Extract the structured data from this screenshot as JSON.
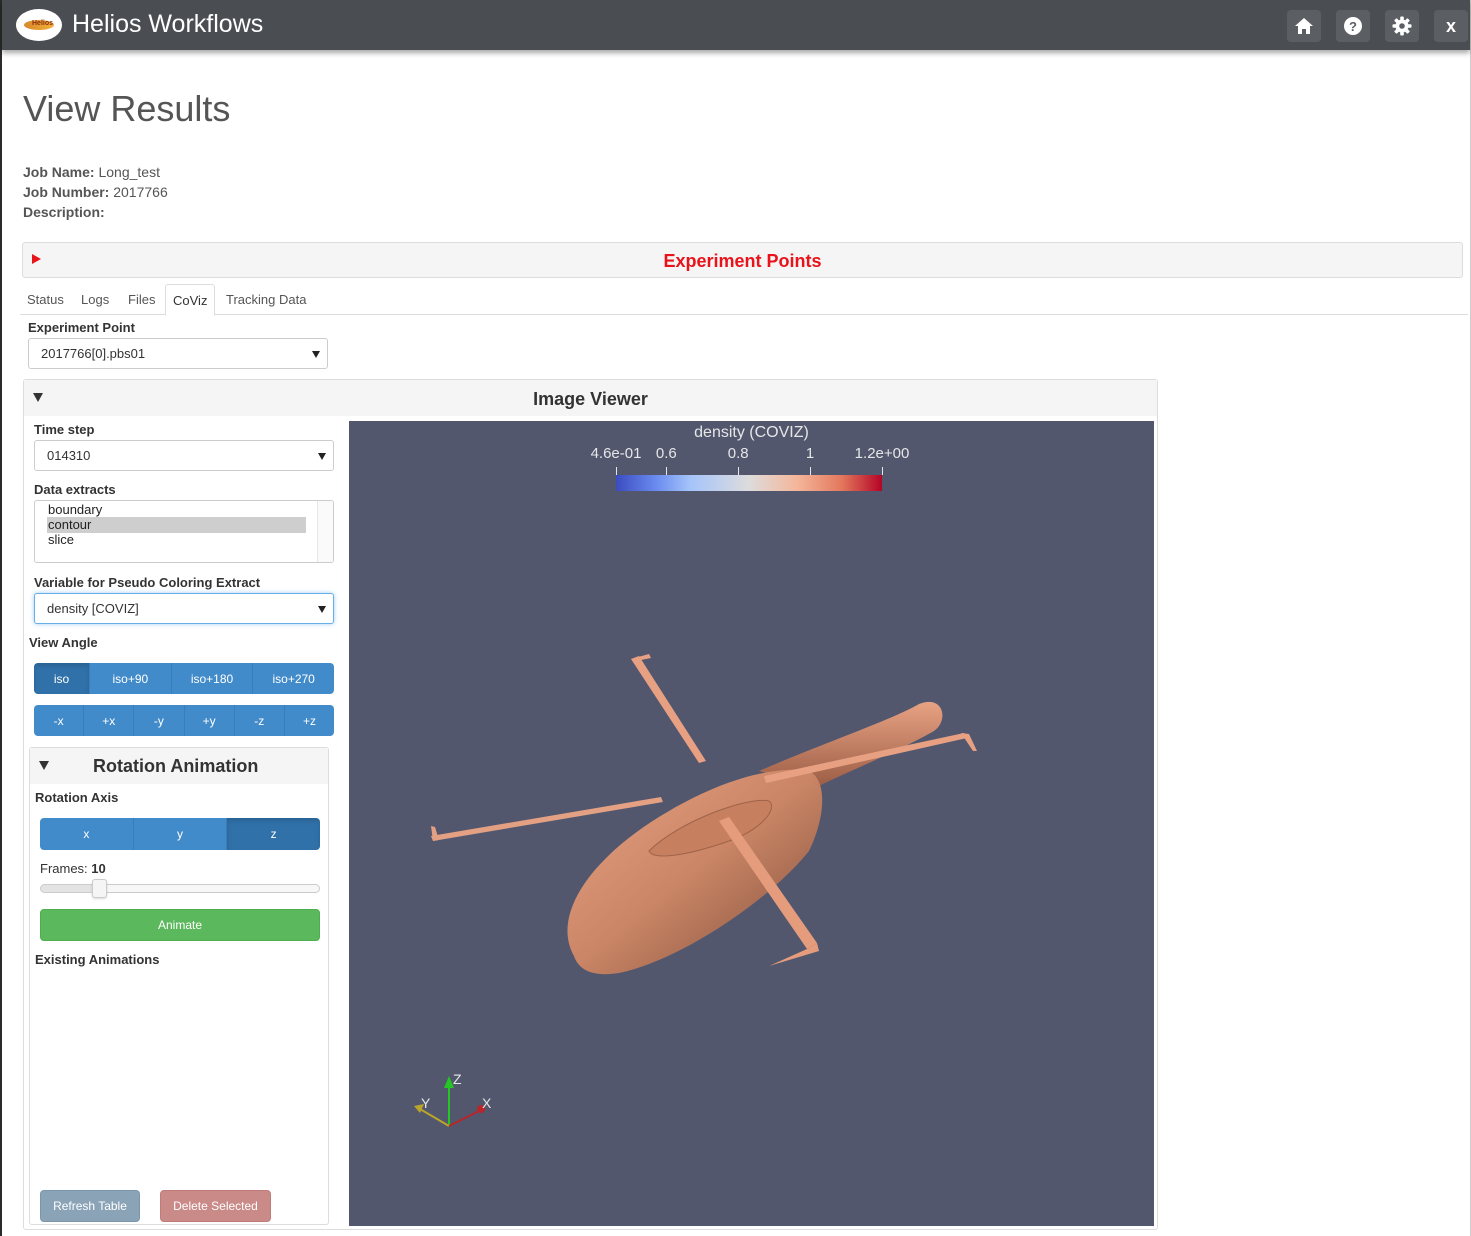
{
  "app": {
    "title": "Helios Workflows",
    "logo_text": "Helios",
    "toolbar": [
      {
        "name": "home",
        "icon": "home-icon"
      },
      {
        "name": "help",
        "icon": "question-circle-icon"
      },
      {
        "name": "settings",
        "icon": "gear-icon"
      },
      {
        "name": "close",
        "icon": "close-icon",
        "label": "x"
      }
    ]
  },
  "page": {
    "title": "View Results",
    "job_name_label": "Job Name:",
    "job_name": "Long_test",
    "job_number_label": "Job Number:",
    "job_number": "2017766",
    "description_label": "Description:",
    "description": ""
  },
  "experiment_points": {
    "title": "Experiment Points",
    "collapsed": true,
    "accent": "#e8131b"
  },
  "tabs": [
    {
      "label": "Status",
      "active": false
    },
    {
      "label": "Logs",
      "active": false
    },
    {
      "label": "Files",
      "active": false
    },
    {
      "label": "CoViz",
      "active": true
    },
    {
      "label": "Tracking Data",
      "active": false
    }
  ],
  "experiment_point": {
    "label": "Experiment Point",
    "value": "2017766[0].pbs01"
  },
  "image_viewer": {
    "title": "Image Viewer",
    "time_step": {
      "label": "Time step",
      "value": "014310"
    },
    "data_extracts": {
      "label": "Data extracts",
      "options": [
        "boundary",
        "contour",
        "slice"
      ],
      "selected": "contour"
    },
    "pseudo_color": {
      "label": "Variable for Pseudo Coloring Extract",
      "value": "density [COVIZ]"
    },
    "view_angle": {
      "label": "View Angle",
      "iso_buttons": [
        {
          "label": "iso",
          "active": true
        },
        {
          "label": "iso+90",
          "active": false
        },
        {
          "label": "iso+180",
          "active": false
        },
        {
          "label": "iso+270",
          "active": false
        }
      ],
      "axis_buttons": [
        {
          "label": "-x"
        },
        {
          "label": "+x"
        },
        {
          "label": "-y"
        },
        {
          "label": "+y"
        },
        {
          "label": "-z"
        },
        {
          "label": "+z"
        }
      ]
    },
    "rotation_animation": {
      "title": "Rotation Animation",
      "axis_label": "Rotation Axis",
      "axes": [
        {
          "label": "x",
          "active": false
        },
        {
          "label": "y",
          "active": false
        },
        {
          "label": "z",
          "active": true
        }
      ],
      "frames_label": "Frames:",
      "frames_value": "10",
      "frames_slider_fraction": 0.21,
      "animate_label": "Animate",
      "existing_label": "Existing Animations",
      "refresh_label": "Refresh Table",
      "delete_label": "Delete Selected"
    },
    "render": {
      "background": "#52576e",
      "colorbar": {
        "title": "density (COVIZ)",
        "min": 0.46,
        "max": 1.2,
        "ticks": [
          {
            "label": "4.6e-01",
            "value": 0.46
          },
          {
            "label": "0.6",
            "value": 0.6
          },
          {
            "label": "0.8",
            "value": 0.8
          },
          {
            "label": "1",
            "value": 1.0
          },
          {
            "label": "1.2e+00",
            "value": 1.2
          }
        ]
      },
      "orientation_axes": {
        "x": "X",
        "y": "Y",
        "z": "Z"
      },
      "model": "helicopter contour",
      "surface_color": "#e19a78"
    }
  }
}
